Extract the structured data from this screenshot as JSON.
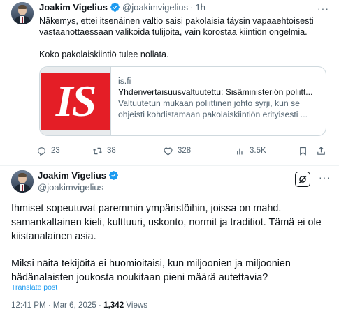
{
  "tweet1": {
    "author_name": "Joakim Vigelius",
    "handle": "@joakimvigelius",
    "separator": "·",
    "time": "1h",
    "text_lines": [
      "Näkemys, ettei itsenäinen valtio saisi pakolaisia täysin vapaaehtoisesti vastaanottaessaan valikoida tulijoita, vain korostaa kiintiön ongelmia.",
      "Koko pakolaiskiintiö tulee nollata."
    ],
    "card": {
      "logo_text": "IS",
      "domain": "is.fi",
      "title": "Yhdenvertaisuusvaltuutettu: Sisäministeriön poliitt...",
      "description": "Valtuutetun mukaan poliittinen johto syrji, kun se ohjeisti kohdistamaan pakolaiskiintiön erityisesti ..."
    },
    "actions": {
      "replies": "23",
      "reposts": "38",
      "likes": "328",
      "views": "3.5K"
    }
  },
  "tweet2": {
    "author_name": "Joakim Vigelius",
    "handle": "@joakimvigelius",
    "paragraphs": [
      "Ihmiset sopeutuvat paremmin ympäristöihin, joissa on mahd. samankaltainen kieli, kulttuuri, uskonto, normit ja traditiot. Tämä ei ole kiistanalainen asia.",
      "Miksi näitä tekijöitä ei huomioitaisi, kun miljoonien ja miljoonien hädänalaisten joukosta noukitaan pieni määrä autettavia?"
    ],
    "translate_label": "Translate post",
    "timestamp": "12:41 PM · Mar 6, 2025",
    "meta_separator": "·",
    "views_count": "1,342",
    "views_label": "Views"
  },
  "colors": {
    "accent": "#1d9bf0",
    "text": "#0f1419",
    "muted": "#536471",
    "border": "#eff3f4",
    "is_red": "#e41e26"
  },
  "icons": [
    "verified-badge-icon",
    "more-icon",
    "reply-icon",
    "retweet-icon",
    "like-icon",
    "views-icon",
    "bookmark-icon",
    "share-icon",
    "grok-icon"
  ]
}
